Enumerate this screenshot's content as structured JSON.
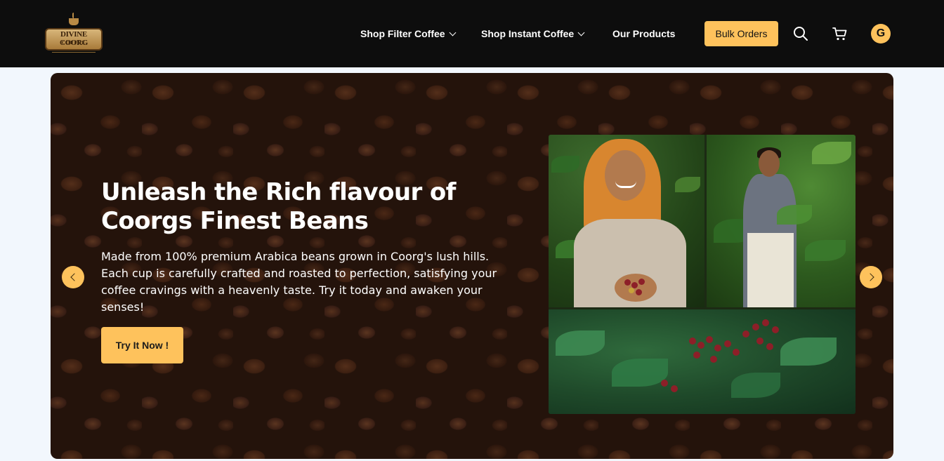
{
  "header": {
    "logo": {
      "line1": "DIVINE COORG",
      "line2": "COFFEE",
      "tagline": "PREMIUM QUALITY"
    },
    "nav": [
      {
        "label": "Shop Filter Coffee",
        "has_dropdown": true
      },
      {
        "label": "Shop Instant Coffee",
        "has_dropdown": true
      },
      {
        "label": "Our Products",
        "has_dropdown": false
      }
    ],
    "bulk_orders_label": "Bulk Orders",
    "icons": [
      "search-icon",
      "cart-icon"
    ],
    "avatar_initial": "G"
  },
  "hero": {
    "title": "Unleash the Rich flavour of Coorgs Finest Beans",
    "description": "Made from 100% premium Arabica beans grown in Coorg's lush hills. Each cup is carefully crafted and roasted to perfection, satisfying your coffee cravings with a heavenly taste. Try it today and awaken your senses!",
    "cta_label": "Try It Now !",
    "prev_icon": "chevron-left-icon",
    "next_icon": "chevron-right-icon"
  },
  "colors": {
    "header_bg": "#0d0d0d",
    "accent": "#fec25c",
    "page_bg": "#f2f7fd",
    "hero_text": "#ffffff"
  }
}
